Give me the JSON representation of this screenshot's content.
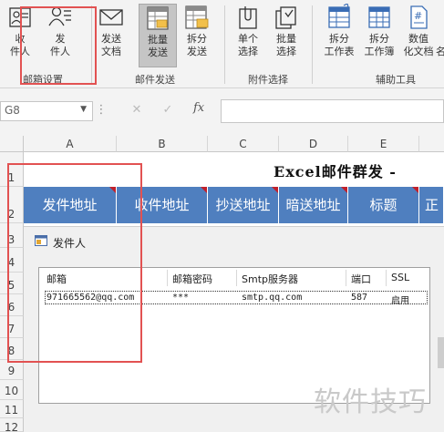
{
  "ribbon": {
    "buttons": [
      {
        "label1": "收",
        "label2": "件人",
        "icon": "receiver-card-icon"
      },
      {
        "label1": "发",
        "label2": "件人",
        "icon": "sender-person-icon"
      },
      {
        "label1": "发送",
        "label2": "文档",
        "icon": "envelope-icon"
      },
      {
        "label1": "批量",
        "label2": "发送",
        "icon": "batch-send-icon"
      },
      {
        "label1": "拆分",
        "label2": "发送",
        "icon": "split-send-icon"
      },
      {
        "label1": "单个",
        "label2": "选择",
        "icon": "clip-single-icon"
      },
      {
        "label1": "批量",
        "label2": "选择",
        "icon": "clip-batch-icon"
      },
      {
        "label1": "拆分",
        "label2": "工作表",
        "icon": "split-sheet-icon"
      },
      {
        "label1": "拆分",
        "label2": "工作簿",
        "icon": "split-book-icon"
      },
      {
        "label1": "数值",
        "label2": "化文档",
        "icon": "numeric-doc-icon"
      },
      {
        "label1": "",
        "label2": "名",
        "icon": "partial-icon"
      }
    ],
    "groups": [
      "邮箱设置",
      "邮件发送",
      "附件选择",
      "辅助工具"
    ]
  },
  "formula_bar": {
    "name_box": "G8",
    "fx": "fx"
  },
  "sheet": {
    "columns": [
      "A",
      "B",
      "C",
      "D",
      "E"
    ],
    "rows": [
      "1",
      "2",
      "3",
      "4",
      "5",
      "6",
      "7",
      "8",
      "9",
      "10",
      "11",
      "12"
    ],
    "title": "Excel邮件群发 -",
    "headers": [
      "发件地址",
      "收件地址",
      "抄送地址",
      "暗送地址",
      "标题",
      "正"
    ]
  },
  "dialog": {
    "title": "发件人",
    "columns": [
      "邮箱",
      "邮箱密码",
      "Smtp服务器",
      "端口",
      "SSL"
    ],
    "rows": [
      {
        "email": "971665562@qq.com",
        "password": "***",
        "smtp": "smtp.qq.com",
        "port": "587",
        "ssl": "启用"
      }
    ]
  },
  "watermark": "软件技巧",
  "colors": {
    "header_blue": "#4f7fbf",
    "highlight_red": "#e25252",
    "comment_marker": "#c0202a"
  }
}
